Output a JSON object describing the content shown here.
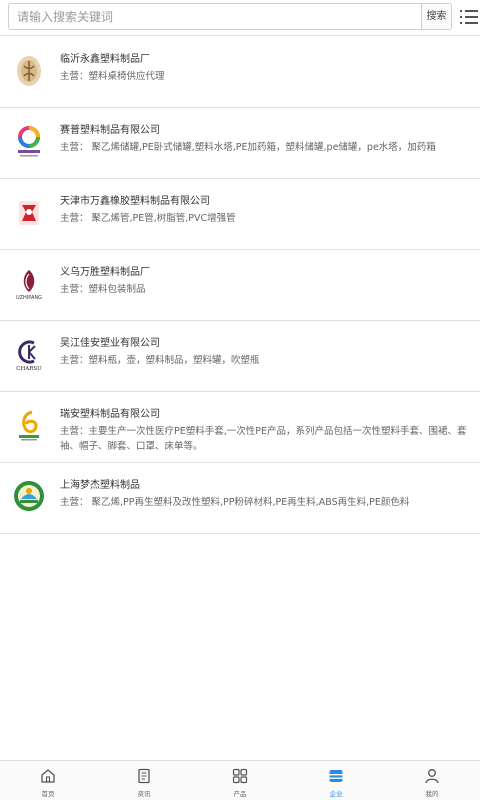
{
  "search": {
    "placeholder": "请输入搜索关键词",
    "button_label": "搜索"
  },
  "menu": {
    "icon": "list-menu-icon"
  },
  "companies": [
    {
      "name": "临沂永鑫塑料制品厂",
      "main": "主营：塑料桌椅供应代理",
      "logo": "yongxin-logo"
    },
    {
      "name": "赛普塑料制品有限公司",
      "main": "主营：  聚乙烯储罐,PE卧式储罐,塑料水塔,PE加药箱，塑料储罐,pe储罐，pe水塔，加药箱",
      "logo": "saipu-logo"
    },
    {
      "name": "天津市万鑫橡胶塑料制品有限公司",
      "main": "主营：  聚乙烯管,PE管,树脂管,PVC增强管",
      "logo": "wanxin-logo"
    },
    {
      "name": "义乌万胜塑料制品厂",
      "main": "主营：塑料包装制品",
      "logo": "wansheng-logo",
      "logo_text": "UZHIPANG"
    },
    {
      "name": "吴江佳安塑业有限公司",
      "main": "主营：塑料瓶，壶，塑料制品，塑料罐，吹塑瓶",
      "logo": "charsu-logo",
      "logo_text": "CHARSU"
    },
    {
      "name": "瑞安塑料制品有限公司",
      "main": "主营：主要生产一次性医疗PE塑料手套,一次性PE产品，系列产品包括一次性塑料手套、围裙、套袖、帽子、脚套、口罩、床单等。",
      "logo": "ruian-logo"
    },
    {
      "name": "上海梦杰塑料制品",
      "main": "主营：  聚乙烯,PP再生塑料及改性塑料,PP粉碎材料,PE再生料,ABS再生料,PE颜色料",
      "logo": "mengjie-logo"
    }
  ],
  "tabs": [
    {
      "label": "首页",
      "icon": "home-icon"
    },
    {
      "label": "资讯",
      "icon": "news-icon"
    },
    {
      "label": "产品",
      "icon": "grid-icon"
    },
    {
      "label": "企业",
      "icon": "company-icon",
      "active": true
    },
    {
      "label": "我的",
      "icon": "user-icon"
    }
  ],
  "colors": {
    "accent": "#2a8be0"
  }
}
